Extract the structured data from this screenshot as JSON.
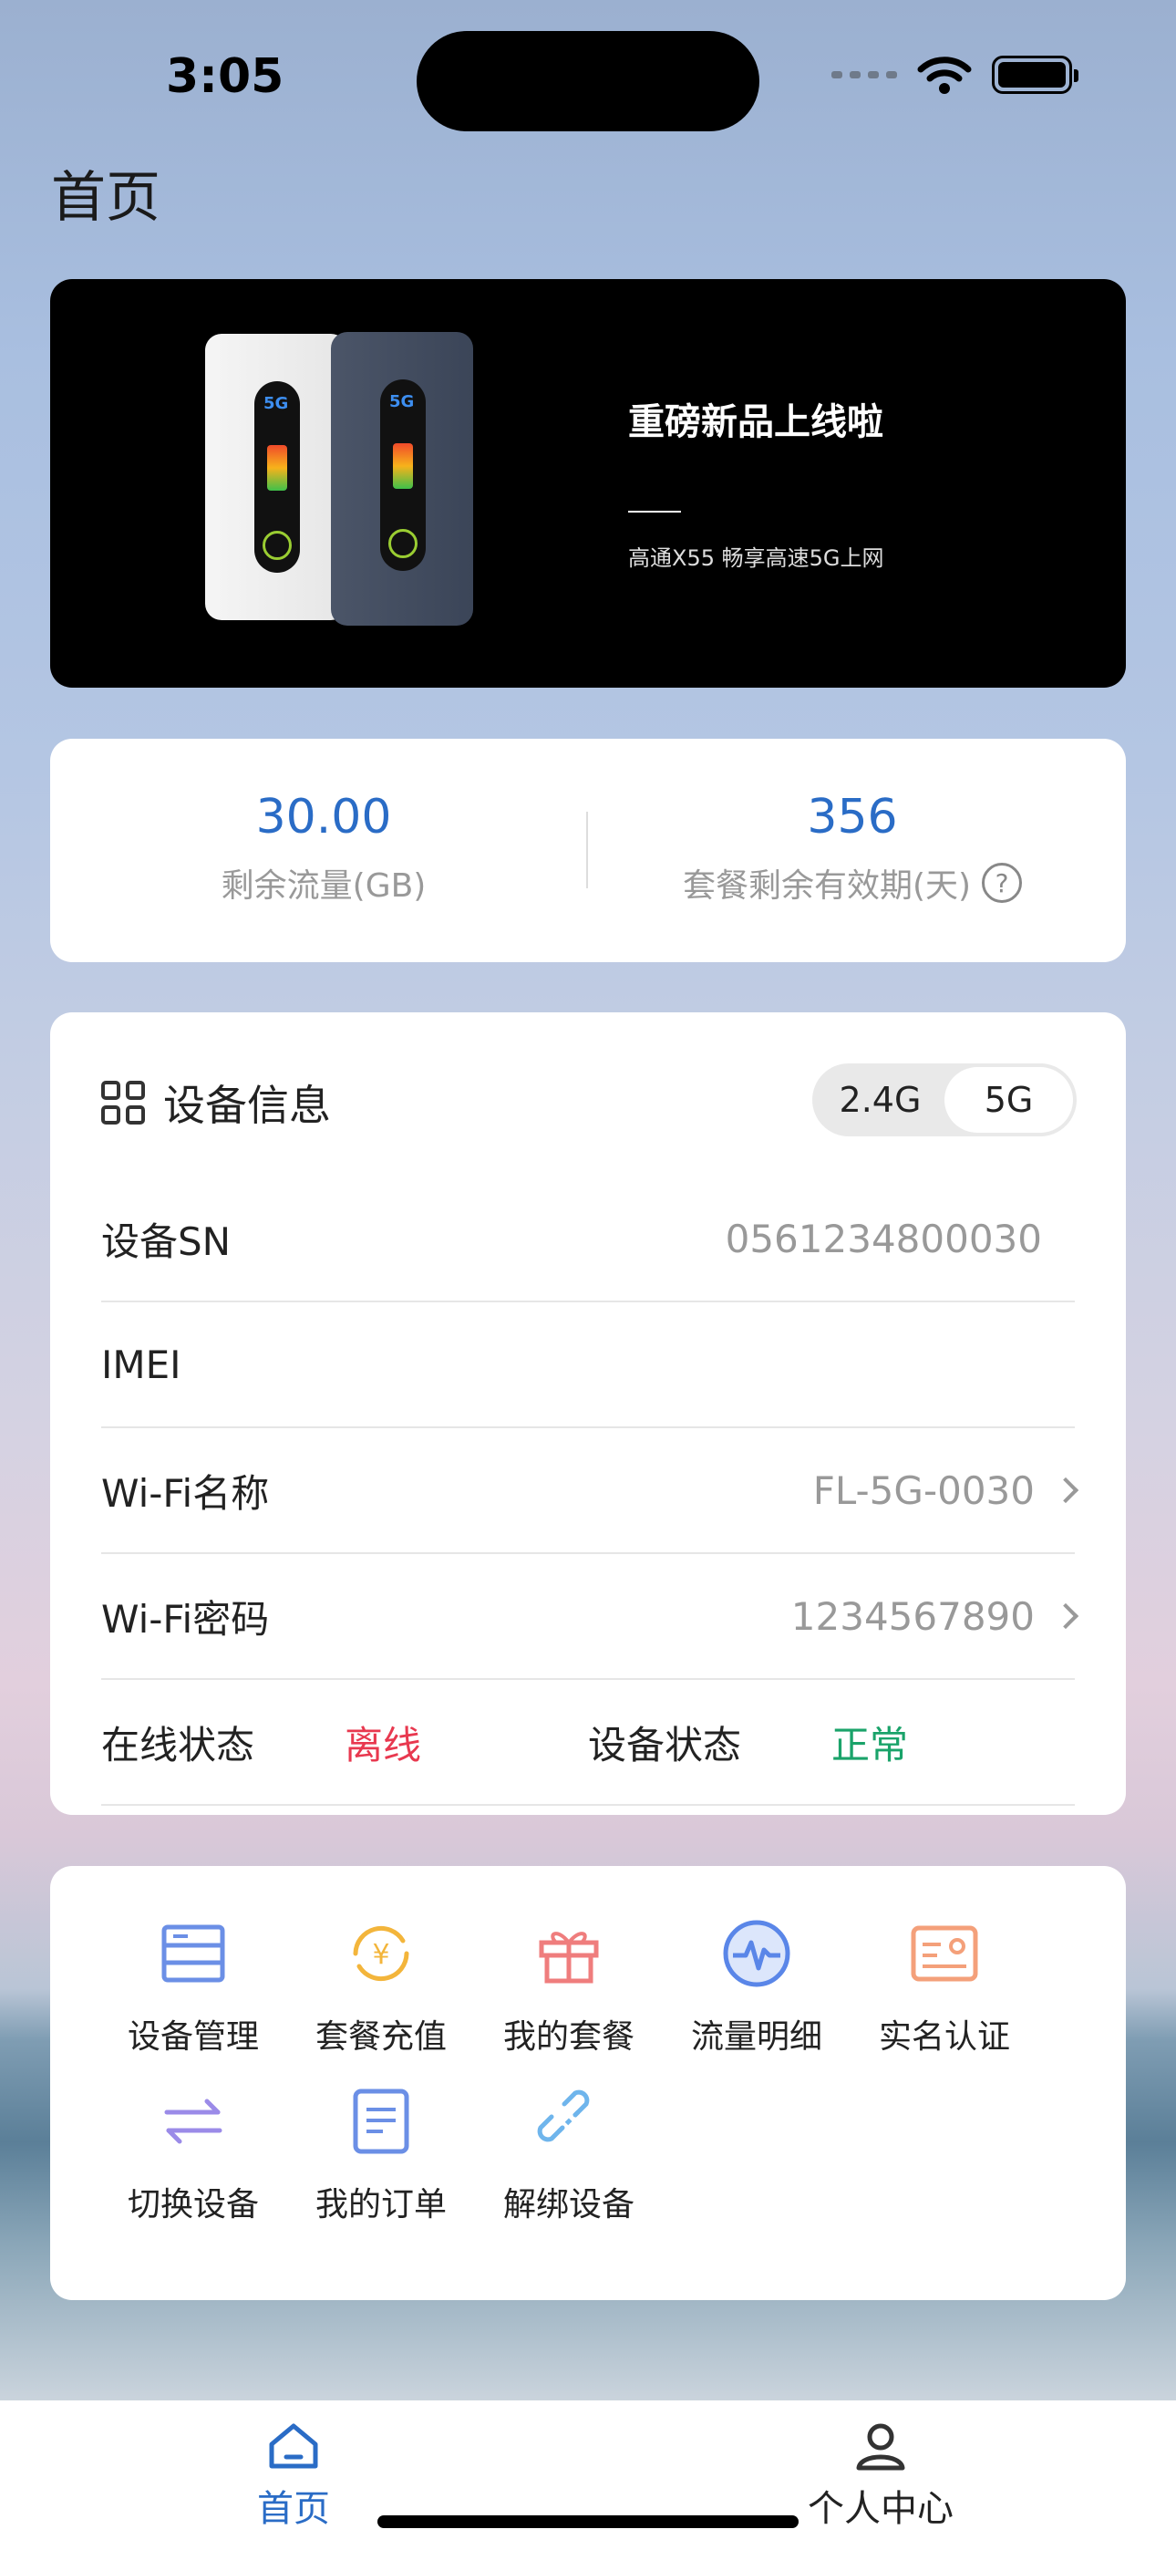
{
  "status_bar": {
    "time": "3:05"
  },
  "page": {
    "title": "首页"
  },
  "banner": {
    "title": "重磅新品上线啦",
    "subtitle": "高通X55 畅享高速5G上网",
    "device_screen_text": "5G"
  },
  "stats": {
    "data_remaining_value": "30.00",
    "data_remaining_label": "剩余流量(GB)",
    "validity_value": "356",
    "validity_label": "套餐剩余有效期(天)",
    "help_glyph": "?"
  },
  "device_info": {
    "title": "设备信息",
    "band_options": [
      "2.4G",
      "5G"
    ],
    "selected_band": "5G",
    "rows": [
      {
        "label": "设备SN",
        "value": "0561234800030"
      },
      {
        "label": "IMEI",
        "value": ""
      },
      {
        "label": "Wi-Fi名称",
        "value": "FL-5G-0030"
      },
      {
        "label": "Wi-Fi密码",
        "value": "1234567890"
      }
    ],
    "online_status_label": "在线状态",
    "online_status_value": "离线",
    "device_status_label": "设备状态",
    "device_status_value": "正常"
  },
  "functions": [
    {
      "label": "设备管理",
      "icon": "device-manage-icon"
    },
    {
      "label": "套餐充值",
      "icon": "recharge-icon"
    },
    {
      "label": "我的套餐",
      "icon": "gift-icon"
    },
    {
      "label": "流量明细",
      "icon": "traffic-detail-icon"
    },
    {
      "label": "实名认证",
      "icon": "id-card-icon"
    },
    {
      "label": "切换设备",
      "icon": "switch-icon"
    },
    {
      "label": "我的订单",
      "icon": "order-icon"
    },
    {
      "label": "解绑设备",
      "icon": "unbind-icon"
    }
  ],
  "tabbar": {
    "home_label": "首页",
    "profile_label": "个人中心",
    "active": "home"
  },
  "colors": {
    "accent": "#2a6cc6",
    "offline": "#e8384f",
    "normal": "#1aa36a"
  }
}
